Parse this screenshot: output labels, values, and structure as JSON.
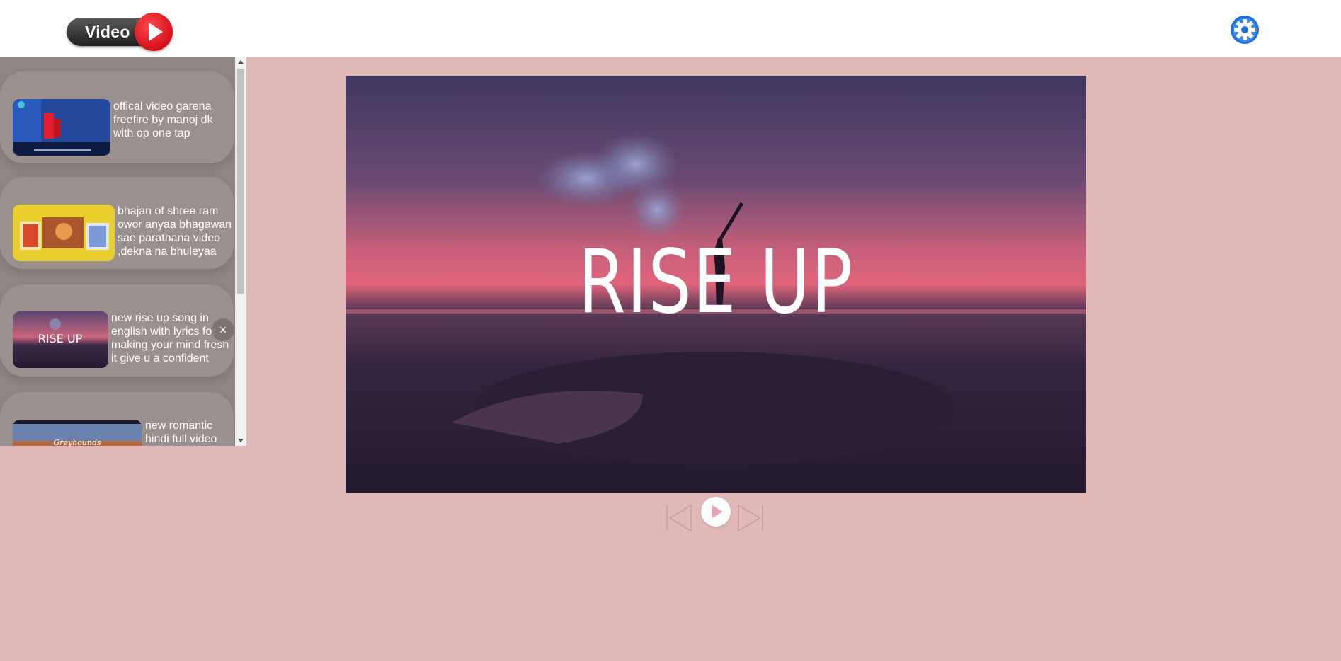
{
  "app": {
    "logo_text": "Video"
  },
  "header": {
    "settings_icon": "gear-icon"
  },
  "playlist": [
    {
      "title": "offical video garena freefire by manoj dk with op one tap",
      "thumb": "gameplay-thumbnail"
    },
    {
      "title": "bhajan of shree ram owor anyaa bhagawan sae parathana video ,dekna na bhuleyaa",
      "thumb": "devotional-thumbnail"
    },
    {
      "title": "new rise up song in english with lyrics for making your mind fresh it give u a confident",
      "thumb": "rise-up-thumbnail",
      "thumb_text": "RISE UP"
    },
    {
      "title": "new romantic hindi full video",
      "thumb": "desert-thumbnail",
      "thumb_text": "Greyhounds"
    }
  ],
  "playlist_close_label": "×",
  "player": {
    "video_title_text": "RISE UP"
  },
  "colors": {
    "background": "#e0b8b8",
    "sidebar": "#8f8683",
    "logo_red": "#d4101c",
    "settings_blue": "#1e6fd9"
  }
}
